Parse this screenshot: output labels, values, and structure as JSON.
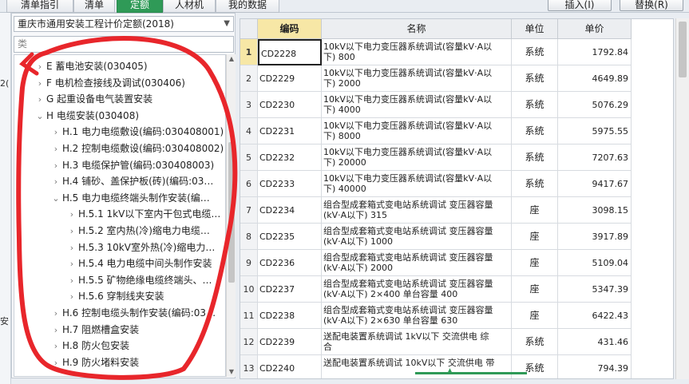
{
  "top_tabs": [
    "清单指引",
    "清单",
    "定额",
    "人材机",
    "我的数据"
  ],
  "active_tab": "定额",
  "toolbar": {
    "insert_label": "插入(I)",
    "replace_label": "替换(R)"
  },
  "left": {
    "quota_select": "重庆市通用安装工程计价定额(2018)",
    "search_placeholder": "类",
    "edge_fragments": [
      "2(",
      "安"
    ]
  },
  "tree": [
    {
      "level": 1,
      "expanded": false,
      "label": "E 蓄电池安装(030405)"
    },
    {
      "level": 1,
      "expanded": false,
      "label": "F 电机检查接线及调试(030406)"
    },
    {
      "level": 1,
      "expanded": false,
      "label": "G 起重设备电气装置安装"
    },
    {
      "level": 1,
      "expanded": true,
      "label": "H 电缆安装(030408)"
    },
    {
      "level": 2,
      "expanded": false,
      "label": "H.1 电力电缆敷设(编码:030408001)"
    },
    {
      "level": 2,
      "expanded": false,
      "label": "H.2 控制电缆敷设(编码:030408002)"
    },
    {
      "level": 2,
      "expanded": false,
      "label": "H.3 电缆保护管(编码:030408003)"
    },
    {
      "level": 2,
      "expanded": false,
      "label": "H.4 铺砂、盖保护板(砖)(编码:03…"
    },
    {
      "level": 2,
      "expanded": true,
      "label": "H.5 电力电缆终端头制作安装(编…"
    },
    {
      "level": 3,
      "expanded": false,
      "label": "H.5.1 1kV以下室内干包式电缆…"
    },
    {
      "level": 3,
      "expanded": false,
      "label": "H.5.2 室内热(冷)缩电力电缆…"
    },
    {
      "level": 3,
      "expanded": false,
      "label": "H.5.3 10kV室外热(冷)缩电力…"
    },
    {
      "level": 3,
      "expanded": false,
      "label": "H.5.4 电力电缆中间头制作安装"
    },
    {
      "level": 3,
      "expanded": false,
      "label": "H.5.5 矿物绝缘电缆终端头、…"
    },
    {
      "level": 3,
      "expanded": false,
      "label": "H.5.6 穿制线夹安装"
    },
    {
      "level": 2,
      "expanded": false,
      "label": "H.6 控制电缆头制作安装(编码:03…"
    },
    {
      "level": 2,
      "expanded": false,
      "label": "H.7 阻燃槽盒安装"
    },
    {
      "level": 2,
      "expanded": false,
      "label": "H.8 防火包安装"
    },
    {
      "level": 2,
      "expanded": false,
      "label": "H.9 防火堵料安装"
    }
  ],
  "table": {
    "headers": [
      "编码",
      "名称",
      "单位",
      "单价"
    ],
    "selected_row": 1,
    "rows": [
      {
        "idx": "1",
        "code": "CD2228",
        "name": [
          "10kV以下电力变压器系统调试(容量kV·A以",
          "下) 800"
        ],
        "unit": "系统",
        "price": "1792.84"
      },
      {
        "idx": "2",
        "code": "CD2229",
        "name": [
          "10kV以下电力变压器系统调试(容量kV·A以",
          "下) 2000"
        ],
        "unit": "系统",
        "price": "4649.89"
      },
      {
        "idx": "3",
        "code": "CD2230",
        "name": [
          "10kV以下电力变压器系统调试(容量kV·A以",
          "下) 4000"
        ],
        "unit": "系统",
        "price": "5076.29"
      },
      {
        "idx": "4",
        "code": "CD2231",
        "name": [
          "10kV以下电力变压器系统调试(容量kV·A以",
          "下) 8000"
        ],
        "unit": "系统",
        "price": "5975.55"
      },
      {
        "idx": "5",
        "code": "CD2232",
        "name": [
          "10kV以下电力变压器系统调试(容量kV·A以",
          "下) 20000"
        ],
        "unit": "系统",
        "price": "7207.63"
      },
      {
        "idx": "6",
        "code": "CD2233",
        "name": [
          "10kV以下电力变压器系统调试(容量kV·A以",
          "下) 40000"
        ],
        "unit": "系统",
        "price": "9417.67"
      },
      {
        "idx": "7",
        "code": "CD2234",
        "name": [
          "组合型成套箱式变电站系统调试 变压器容量",
          "(kV·A以下) 315"
        ],
        "unit": "座",
        "price": "3098.15"
      },
      {
        "idx": "8",
        "code": "CD2235",
        "name": [
          "组合型成套箱式变电站系统调试 变压器容量",
          "(kV·A以下) 1000"
        ],
        "unit": "座",
        "price": "3917.89"
      },
      {
        "idx": "9",
        "code": "CD2236",
        "name": [
          "组合型成套箱式变电站系统调试 变压器容量",
          "(kV·A以下) 2000"
        ],
        "unit": "座",
        "price": "5109.04"
      },
      {
        "idx": "10",
        "code": "CD2237",
        "name": [
          "组合型成套箱式变电站系统调试 变压器容量",
          "(kV·A以下) 2×400 单台容量 400"
        ],
        "unit": "座",
        "price": "5347.39"
      },
      {
        "idx": "11",
        "code": "CD2238",
        "name": [
          "组合型成套箱式变电站系统调试 变压器容量",
          "(kV·A以下) 2×630 单台容量 630"
        ],
        "unit": "座",
        "price": "6422.43"
      },
      {
        "idx": "12",
        "code": "CD2239",
        "name": [
          "送配电装置系统调试 1kV以下 交流供电 综",
          "合"
        ],
        "unit": "系统",
        "price": "431.46"
      },
      {
        "idx": "13",
        "code": "CD2240",
        "name": [
          "送配电装置系统调试 10kV以下 交流供电 带",
          ""
        ],
        "unit": "系统",
        "price": "794.39"
      }
    ]
  },
  "colors": {
    "active_tab": "#2f9a57",
    "selected_code_header": "#f7e7a6",
    "annotation": "#e8262b"
  }
}
